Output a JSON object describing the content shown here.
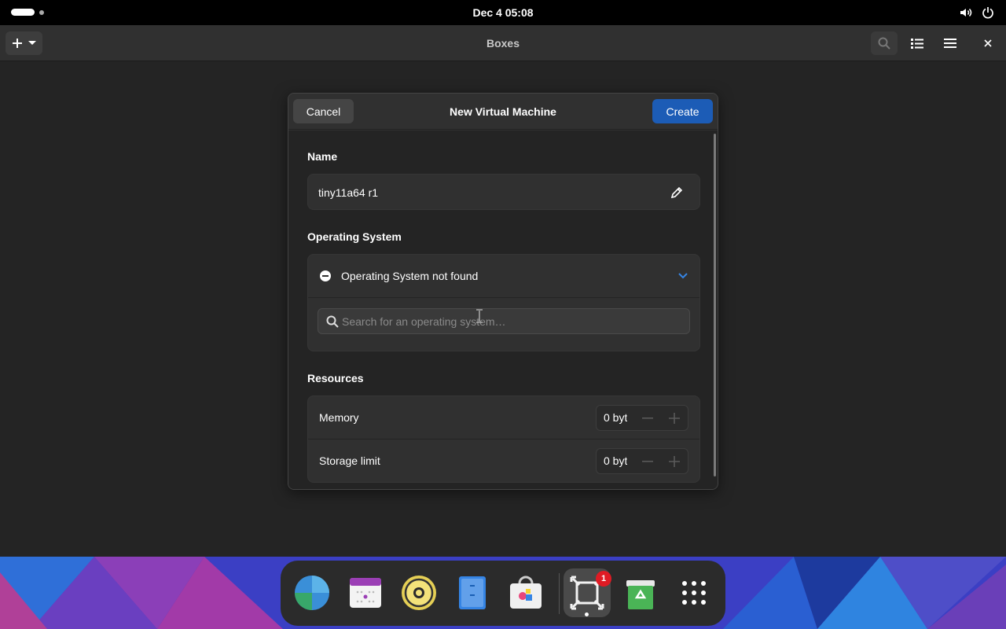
{
  "topbar": {
    "clock": "Dec 4  05:08"
  },
  "app": {
    "title": "Boxes"
  },
  "dialog": {
    "cancel_label": "Cancel",
    "title": "New Virtual Machine",
    "create_label": "Create",
    "name_section": "Name",
    "name_value": "tiny11a64 r1",
    "os_section": "Operating System",
    "os_status": "Operating System not found",
    "os_search_placeholder": "Search for an operating system…",
    "resources_section": "Resources",
    "memory_label": "Memory",
    "memory_value": "0 byt",
    "storage_label": "Storage limit",
    "storage_value": "0 byt"
  },
  "dock": {
    "items": [
      "web-browser",
      "calendar",
      "rhythmbox",
      "files",
      "software",
      "boxes",
      "trash",
      "app-grid"
    ],
    "boxes_badge": "1"
  },
  "colors": {
    "accent": "#1c5cb6",
    "window_bg": "#242424",
    "headerbar_bg": "#303030",
    "badge": "#e01b24"
  }
}
